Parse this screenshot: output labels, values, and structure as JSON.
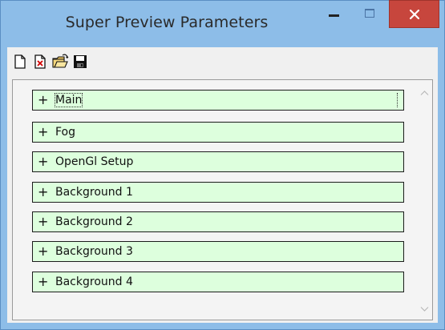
{
  "window": {
    "title": "Super Preview Parameters"
  },
  "titlebar_buttons": {
    "minimize_icon": "minimize-icon",
    "maximize_icon": "maximize-icon",
    "close_icon": "close-icon",
    "close_color": "#c7463d"
  },
  "toolbar": {
    "buttons": [
      {
        "icon": "new-file-icon"
      },
      {
        "icon": "delete-file-icon"
      },
      {
        "icon": "open-folder-icon"
      },
      {
        "icon": "save-disk-icon"
      }
    ]
  },
  "sections": [
    {
      "expander": "+",
      "label": "Main",
      "focused": true
    },
    {
      "expander": "+",
      "label": "Fog"
    },
    {
      "expander": "+",
      "label": "OpenGl Setup"
    },
    {
      "expander": "+",
      "label": "Background 1"
    },
    {
      "expander": "+",
      "label": "Background 2"
    },
    {
      "expander": "+",
      "label": "Background 3"
    },
    {
      "expander": "+",
      "label": "Background 4"
    }
  ],
  "colors": {
    "titlebar": "#8dbde8",
    "section_fill": "#ddffdd",
    "section_border": "#1c1c1c"
  }
}
